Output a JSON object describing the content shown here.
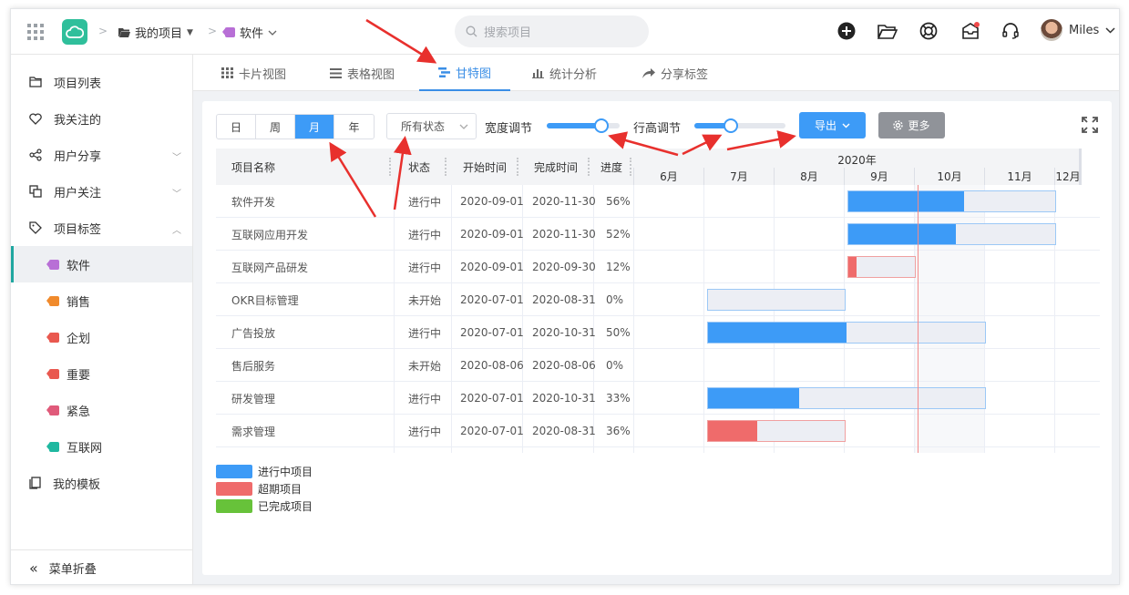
{
  "header": {
    "breadcrumb_project": "我的项目",
    "breadcrumb_tag": "软件",
    "search_placeholder": "搜索项目",
    "user_name": "Miles"
  },
  "sidebar": {
    "items": [
      {
        "label": "项目列表"
      },
      {
        "label": "我关注的"
      },
      {
        "label": "用户分享"
      },
      {
        "label": "用户关注"
      },
      {
        "label": "项目标签"
      }
    ],
    "tags": [
      {
        "label": "软件",
        "color": "#b86fd6"
      },
      {
        "label": "销售",
        "color": "#f08a2c"
      },
      {
        "label": "企划",
        "color": "#e9584f"
      },
      {
        "label": "重要",
        "color": "#e9584f"
      },
      {
        "label": "紧急",
        "color": "#e05a7a"
      },
      {
        "label": "互联网",
        "color": "#1fb8a0"
      }
    ],
    "templates": "我的模板",
    "collapse": "菜单折叠"
  },
  "tabs": [
    {
      "label": "卡片视图"
    },
    {
      "label": "表格视图"
    },
    {
      "label": "甘特图"
    },
    {
      "label": "统计分析"
    },
    {
      "label": "分享标签"
    }
  ],
  "toolbar": {
    "scales": [
      "日",
      "周",
      "月",
      "年"
    ],
    "active_scale": "月",
    "status_filter": "所有状态",
    "width_label": "宽度调节",
    "width_level": 0.75,
    "height_label": "行高调节",
    "height_level": 0.4,
    "export_label": "导出",
    "more_label": "更多"
  },
  "table": {
    "columns": [
      "项目名称",
      "状态",
      "开始时间",
      "完成时间",
      "进度"
    ],
    "rows": [
      [
        "软件开发",
        "进行中",
        "2020-09-01",
        "2020-11-30",
        "56%"
      ],
      [
        "互联网应用开发",
        "进行中",
        "2020-09-01",
        "2020-11-30",
        "52%"
      ],
      [
        "互联网产品研发",
        "进行中",
        "2020-09-01",
        "2020-09-30",
        "12%"
      ],
      [
        "OKR目标管理",
        "未开始",
        "2020-07-01",
        "2020-08-31",
        "0%"
      ],
      [
        "广告投放",
        "进行中",
        "2020-07-01",
        "2020-10-31",
        "50%"
      ],
      [
        "售后服务",
        "未开始",
        "2020-08-06",
        "2020-08-06",
        "0%"
      ],
      [
        "研发管理",
        "进行中",
        "2020-07-01",
        "2020-10-31",
        "33%"
      ],
      [
        "需求管理",
        "进行中",
        "2020-07-01",
        "2020-08-31",
        "36%"
      ]
    ]
  },
  "gantt": {
    "year": "2020年",
    "months": [
      "6月",
      "7月",
      "8月",
      "9月",
      "10月",
      "11月",
      "12月"
    ],
    "today_month_offset": 4.0,
    "bars": [
      {
        "start": 3.0,
        "end": 5.97,
        "progress": 0.56,
        "kind": "ongoing"
      },
      {
        "start": 3.0,
        "end": 5.97,
        "progress": 0.52,
        "kind": "ongoing"
      },
      {
        "start": 3.0,
        "end": 3.97,
        "progress": 0.12,
        "kind": "overdue"
      },
      {
        "start": 1.0,
        "end": 2.97,
        "progress": 0.0,
        "kind": "ongoing"
      },
      {
        "start": 1.0,
        "end": 4.97,
        "progress": 0.5,
        "kind": "ongoing"
      },
      null,
      {
        "start": 1.0,
        "end": 4.97,
        "progress": 0.33,
        "kind": "ongoing"
      },
      {
        "start": 1.0,
        "end": 2.97,
        "progress": 0.36,
        "kind": "overdue"
      }
    ],
    "colors": {
      "ongoing": "#3d9bf7",
      "overdue": "#ef6b6b",
      "done": "#67c23a"
    }
  },
  "legend": [
    {
      "label": "进行中项目",
      "color": "#3d9bf7"
    },
    {
      "label": "超期项目",
      "color": "#ef6b6b"
    },
    {
      "label": "已完成项目",
      "color": "#67c23a"
    }
  ]
}
